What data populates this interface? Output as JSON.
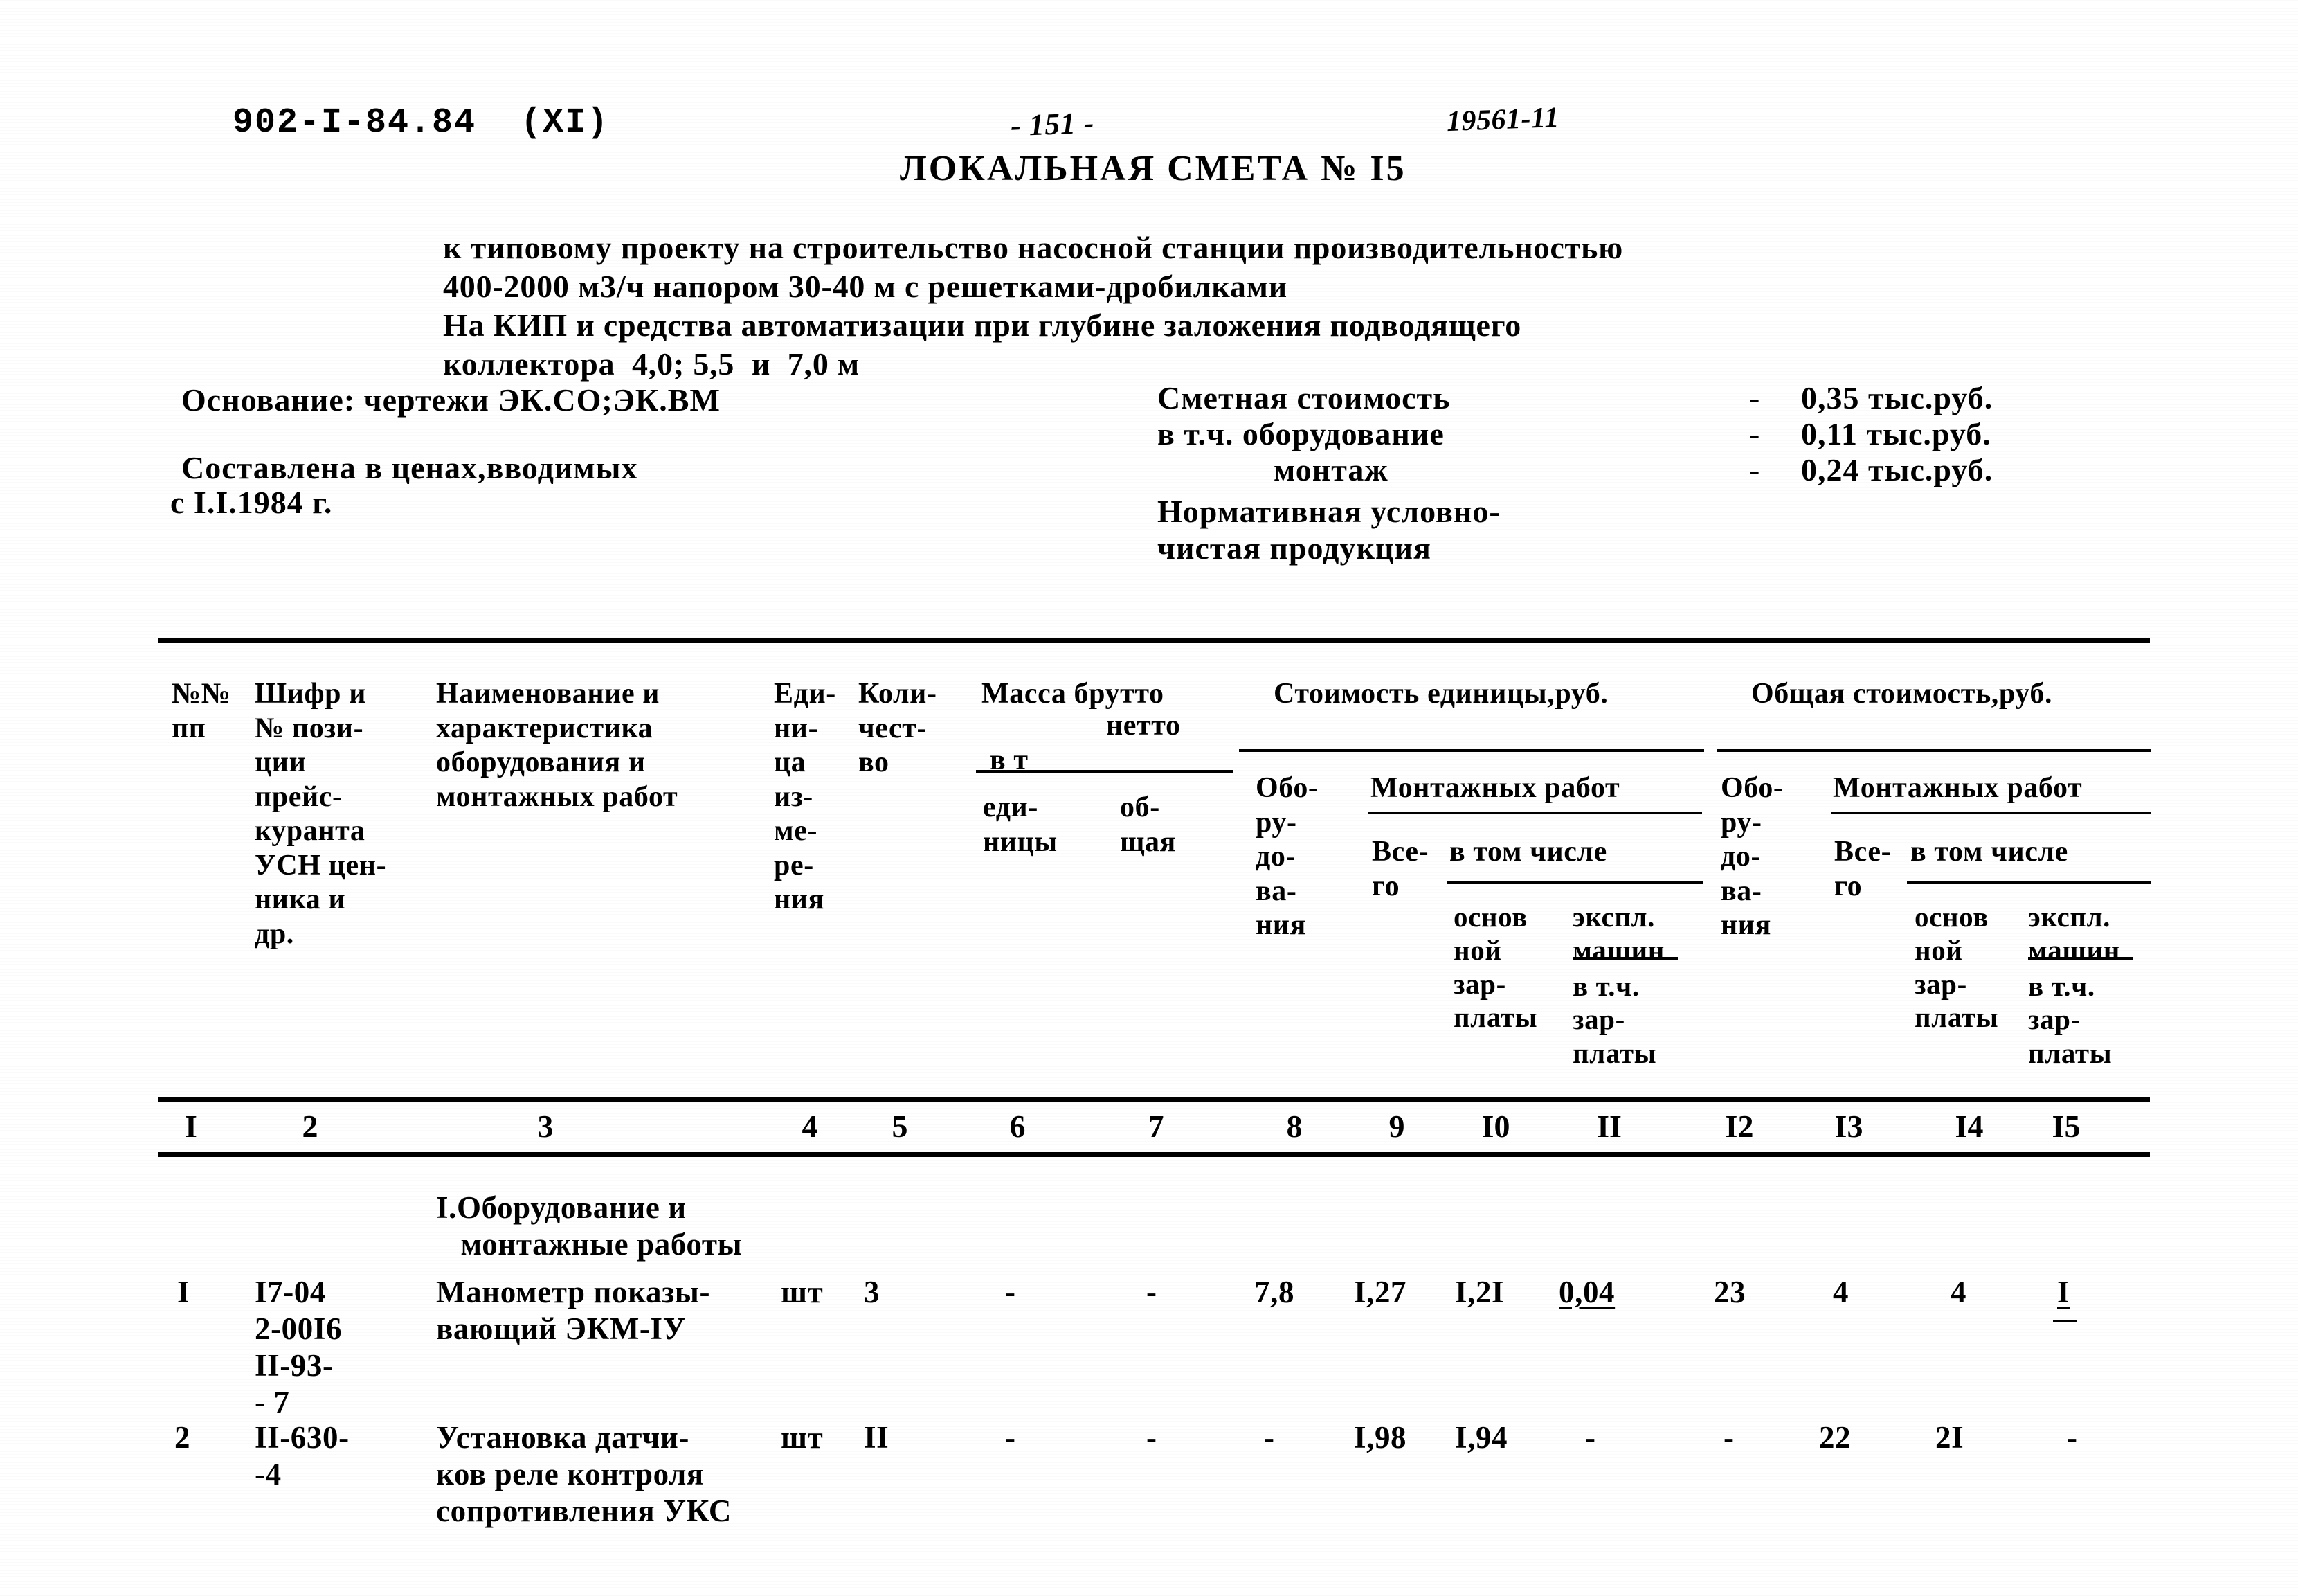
{
  "header": {
    "doc_code": "902-I-84.84  (XI)",
    "page_number": "- 151 -",
    "stamp_code": "19561-11",
    "title": "ЛОКАЛЬНАЯ СМЕТА № I5"
  },
  "description": {
    "line1": "к типовому проекту на строительство насосной станции производительностью",
    "line2": "400-2000 м3/ч напором 30-40 м с решетками-дробилками",
    "line3": "На КИП и средства автоматизации при глубине заложения подводящего",
    "line4": "коллектора  4,0; 5,5  и  7,0 м"
  },
  "basis": {
    "osnovanie": "Основание: чертежи ЭК.СО;ЭК.ВМ",
    "prices_line1": "Составлена в ценах,вводимых",
    "prices_line2": "с I.I.1984 г."
  },
  "cost_summary": {
    "rows": [
      {
        "label": "Сметная стоимость",
        "dash": "-",
        "value": "0,35 тыс.руб."
      },
      {
        "label": "в т.ч. оборудование",
        "dash": "-",
        "value": "0,11 тыс.руб."
      },
      {
        "label": "монтаж",
        "dash": "-",
        "value": "0,24 тыс.руб."
      }
    ],
    "nchp_line1": "Нормативная условно-",
    "nchp_line2": "чистая продукция"
  },
  "table": {
    "headers": {
      "col1": "№№\nпп",
      "col2": "Шифр и\n№ пози-\nции\nпрейс-\nкуранта\nУСН цен-\nника и\nдр.",
      "col3": "Наименование и\nхарактеристика\nоборудования и\nмонтажных работ",
      "col4": "Еди-\nни-\nца\nиз-\nме-\nре-\nния",
      "col5": "Коли-\nчест-\nво",
      "mass_group": "Масса брутто",
      "mass_netto": "нетто",
      "mass_vt": "в т",
      "col6": "еди-\nницы",
      "col7": "об-\nщая",
      "group_unit_cost": "Стоимость единицы,руб.",
      "group_total_cost": "Общая стоимость,руб.",
      "col8": "Обо-\nру-\nдо-\nва-\nния",
      "montage_unit": "Монтажных работ",
      "col9": "Все-\nго",
      "vtom_unit": "в том числе",
      "col10": "основ\nной\nзар-\nплаты",
      "col11": "экспл.\nмашин",
      "col11b": "в т.ч.\nзар-\nплаты",
      "col12": "Обо-\nру-\nдо-\nва-\nния",
      "montage_total": "Монтажных работ",
      "col13": "Все-\nго",
      "vtom_total": "в том числе",
      "col14": "основ\nной\nзар-\nплаты",
      "col15": "экспл.\nмашин",
      "col15b": "в т.ч.\nзар-\nплаты"
    },
    "column_numbers": [
      "I",
      "2",
      "3",
      "4",
      "5",
      "6",
      "7",
      "8",
      "9",
      "I0",
      "II",
      "I2",
      "I3",
      "I4",
      "I5"
    ],
    "section_title": "I.Оборудование и\n   монтажные работы",
    "rows": [
      {
        "num": "I",
        "code": "I7-04\n2-00I6\nII-93-\n- 7",
        "name": "Манометр показы-\nвающий ЭКМ-IУ",
        "unit": "шт",
        "qty": "3",
        "mass_unit": "-",
        "mass_total": "-",
        "c8": "7,8",
        "c9": "I,27",
        "c10": "I,2I",
        "c11": "0,04",
        "c11_underlined": true,
        "c12": "23",
        "c13": "4",
        "c14": "4",
        "c15": "I",
        "c15_underlined": true
      },
      {
        "num": "2",
        "code": "II-630-\n-4",
        "name": "Установка датчи-\nков реле контроля\nсопротивления УКС",
        "unit": "шт",
        "qty": "II",
        "mass_unit": "-",
        "mass_total": "-",
        "c8": "-",
        "c9": "I,98",
        "c10": "I,94",
        "c11": "-",
        "c11_underlined": false,
        "c12": "-",
        "c13": "22",
        "c14": "2I",
        "c15": "-",
        "c15_underlined": false
      }
    ]
  }
}
